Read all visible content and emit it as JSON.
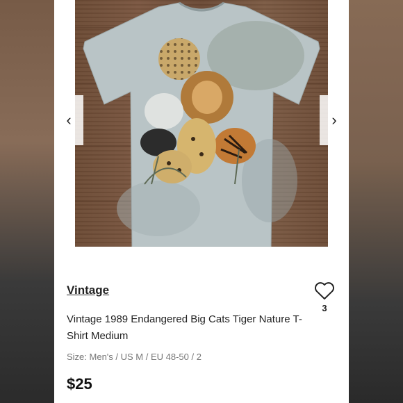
{
  "listing": {
    "brand": "Vintage",
    "title": "Vintage 1989 Endangered Big Cats Tiger Nature T-Shirt Medium",
    "size": "Size: Men's / US M / EU 48-50 / 2",
    "price": "$25",
    "likes": "3"
  },
  "carousel": {
    "prev_icon": "chevron-left-icon",
    "next_icon": "chevron-right-icon",
    "prev_glyph": "‹",
    "next_glyph": "›"
  },
  "icons": {
    "like": "heart-outline-icon"
  },
  "colors": {
    "text": "#222222",
    "muted": "#777777",
    "background": "#ffffff"
  }
}
